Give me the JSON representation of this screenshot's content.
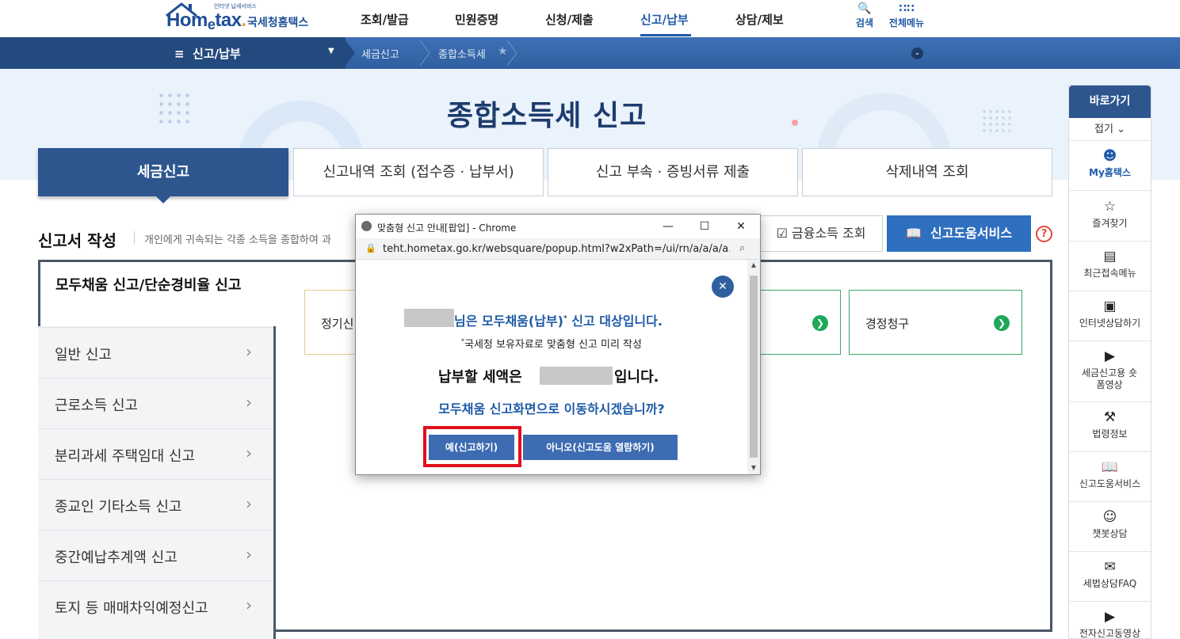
{
  "header": {
    "logo_small": "인터넷 납세서비스",
    "logo_brand_left": "Hom",
    "logo_brand_e": "e",
    "logo_brand_right": "tax",
    "logo_brand_dot": ".",
    "logo_ko": "국세청홈택스",
    "gnb": [
      "조회/발급",
      "민원증명",
      "신청/제출",
      "신고/납부",
      "상담/제보"
    ],
    "active_gnb": "신고/납부",
    "search_label": "검색",
    "all_menu_label": "전체메뉴"
  },
  "subnav": {
    "menu": "신고/납부",
    "crumbs": [
      "세금신고",
      "종합소득세"
    ]
  },
  "banner": {
    "title": "종합소득세 신고"
  },
  "tabs": [
    "세금신고",
    "신고내역 조회 (접수증 · 납부서)",
    "신고 부속 · 증빙서류 제출",
    "삭제내역 조회"
  ],
  "section": {
    "title": "신고서 작성",
    "desc": "개인에게 귀속되는 각종 소득을 종합하여 과",
    "finance_btn": "금융소득 조회",
    "help_btn": "신고도움서비스",
    "help_icon": "?"
  },
  "sidebar": {
    "active": "모두채움 신고/단순경비율 신고",
    "items": [
      "일반 신고",
      "근로소득 신고",
      "분리과세 주택임대 신고",
      "종교인 기타소득 신고",
      "중간예납추계액 신고",
      "토지 등 매매차익예정신고"
    ]
  },
  "cards": [
    {
      "label": "정기신"
    },
    {
      "label": "경정청구"
    }
  ],
  "quick": {
    "head": "바로가기",
    "fold": "접기",
    "items": [
      {
        "label": "My홈택스",
        "icon": "user-icon"
      },
      {
        "label": "즐겨찾기",
        "icon": "star-icon"
      },
      {
        "label": "최근접속메뉴",
        "icon": "recent-icon"
      },
      {
        "label": "인터넷상담하기",
        "icon": "monitor-icon"
      },
      {
        "label": "세금신고용 숏폼영상",
        "icon": "play-icon"
      },
      {
        "label": "법령정보",
        "icon": "gavel-icon"
      },
      {
        "label": "신고도움서비스",
        "icon": "book-icon"
      },
      {
        "label": "챗봇상담",
        "icon": "chatbot-icon"
      },
      {
        "label": "세법상담FAQ",
        "icon": "faq-icon"
      },
      {
        "label": "전자신고동영상",
        "icon": "video-icon"
      }
    ]
  },
  "popup": {
    "window_title": "맞춤형 신고 안내[팝업] - Chrome",
    "url": "teht.hometax.go.kr/websquare/popup.html?w2xPath=/ui/rn/a/a/a/a...",
    "line1": "님은 모두채움(납부)",
    "line1_sup": "*",
    "line1_tail": " 신고 대상입니다.",
    "line2_sup": "*",
    "line2": "국세청 보유자료로 맞춤형 신고 미리 작성",
    "line3a": "납부할 세액은",
    "line3b": "입니다.",
    "line4": "모두채움 신고화면으로 이동하시겠습니까?",
    "yes": "예(신고하기)",
    "no": "아니오(신고도움 열람하기)"
  },
  "colors": {
    "primary": "#2d568f",
    "accent_blue": "#1e5aa8",
    "highlight_red": "#e0101b",
    "go_green": "#1fa85a"
  }
}
